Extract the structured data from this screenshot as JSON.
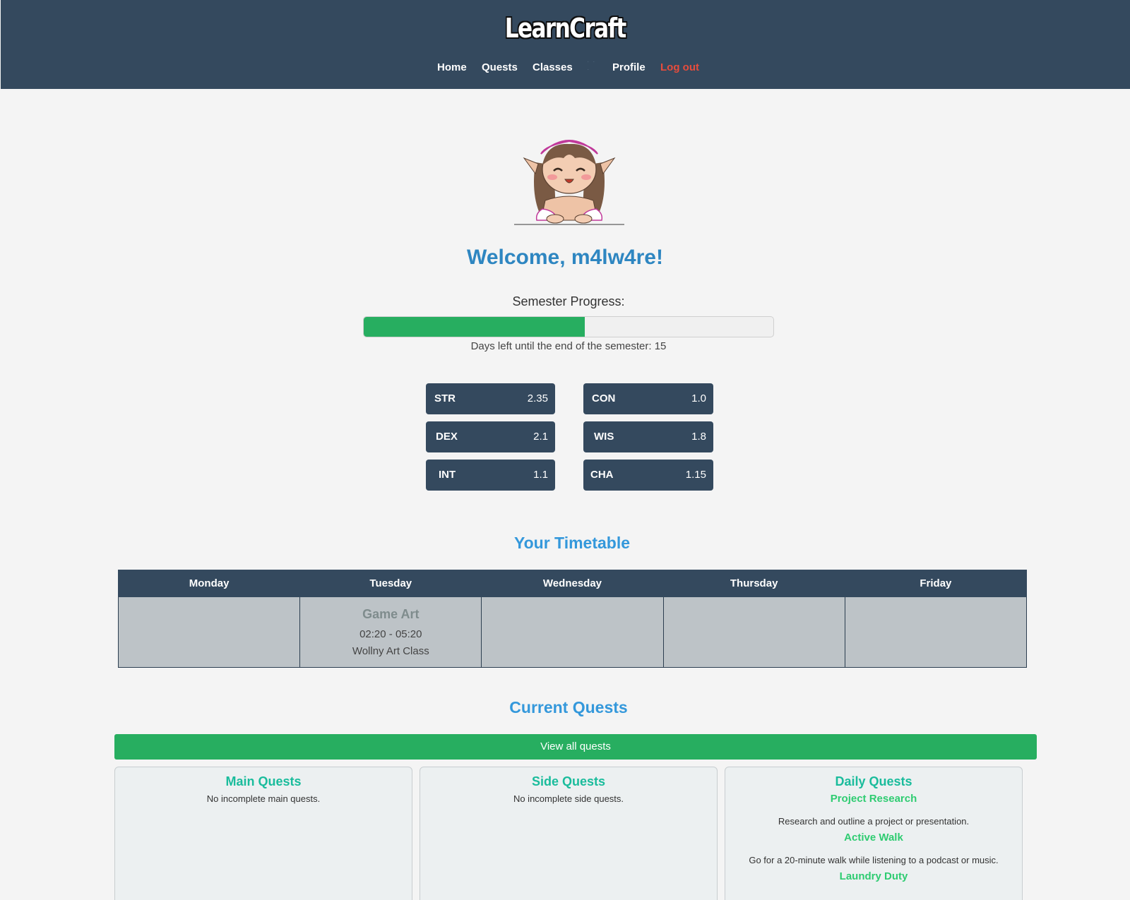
{
  "header": {
    "logo": "LearnCraft",
    "nav": {
      "home": "Home",
      "quests": "Quests",
      "classes": "Classes",
      "profile": "Profile",
      "logout": "Log out"
    }
  },
  "welcome": "Welcome, m4lw4re!",
  "semester": {
    "label": "Semester Progress:",
    "progress_percent": 54,
    "days_left": "Days left until the end of the semester: 15"
  },
  "stats": {
    "str": {
      "name": "STR",
      "value": "2.35"
    },
    "dex": {
      "name": "DEX",
      "value": "2.1"
    },
    "int": {
      "name": "INT",
      "value": "1.1"
    },
    "con": {
      "name": "CON",
      "value": "1.0"
    },
    "wis": {
      "name": "WIS",
      "value": "1.8"
    },
    "cha": {
      "name": "CHA",
      "value": "1.15"
    }
  },
  "timetable": {
    "title": "Your Timetable",
    "days": [
      "Monday",
      "Tuesday",
      "Wednesday",
      "Thursday",
      "Friday"
    ],
    "tuesday_class": {
      "name": "Game Art",
      "time": "02:20 - 05:20",
      "location": "Wollny Art Class"
    }
  },
  "quests": {
    "title": "Current Quests",
    "view_all": "View all quests",
    "main": {
      "title": "Main Quests",
      "empty": "No incomplete main quests."
    },
    "side": {
      "title": "Side Quests",
      "empty": "No incomplete side quests."
    },
    "daily": {
      "title": "Daily Quests",
      "items": [
        {
          "title": "Project Research",
          "desc": "Research and outline a project or presentation."
        },
        {
          "title": "Active Walk",
          "desc": "Go for a 20-minute walk while listening to a podcast or music."
        },
        {
          "title": "Laundry Duty",
          "desc": ""
        }
      ]
    }
  },
  "colors": {
    "header_bg": "#34495e",
    "accent_blue": "#2e86c1",
    "progress_green": "#27ae60",
    "logout_red": "#e74c3c",
    "quest_teal": "#1abc9c"
  }
}
